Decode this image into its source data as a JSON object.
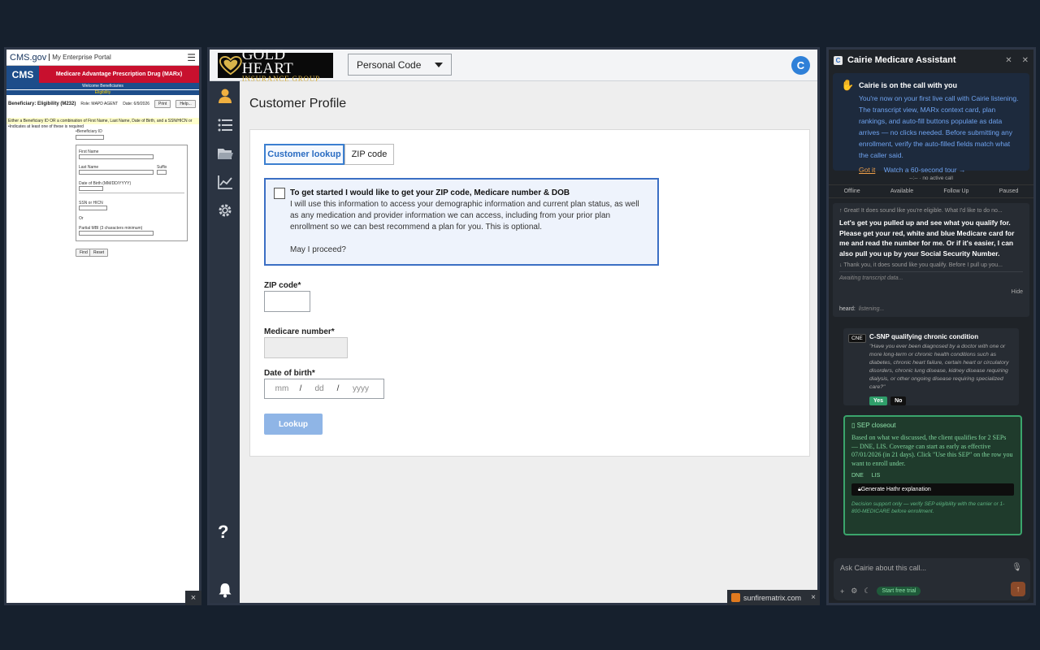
{
  "cms": {
    "brand": "CMS.gov",
    "portal": "My Enterprise Portal",
    "logo": "CMS",
    "banner_title": "Medicare Advantage Prescription Drug (MARx)",
    "welcome": "Welcome Beneficiaries",
    "eligibility": "Eligibility",
    "bene_title": "Beneficiary: Eligibility (M232)",
    "role": "Role: MAPD AGENT",
    "date": "Date: 6/9/2026",
    "print_label": "Print",
    "help_label": "Help...",
    "instructions": "Either a Beneficiary ID OR a combination of First Name, Last Name, Date of Birth, and a SSN/HICN or",
    "required_note": "•Indicates at least one of these is required",
    "beneficiary_id_label": "•Beneficiary ID",
    "first_name_label": "First Name",
    "last_name_label": "Last Name",
    "suffix_label": "Suffix",
    "dob_label": "Date of Birth (MM/DD/YYYY)",
    "ssn_label": "SSN or HICN",
    "or_label": "Or",
    "mbi_label": "Partial MBI (3 characters minimum)",
    "find_label": "Find",
    "reset_label": "Reset",
    "close_label": "×"
  },
  "main": {
    "logo_title": "GOLD HEART",
    "logo_subtitle": "INSURANCE GROUP",
    "personal_code": "Personal Code",
    "avatar_initial": "C",
    "page_title": "Customer Profile",
    "tabs": [
      {
        "label": "Customer lookup"
      },
      {
        "label": "ZIP code"
      }
    ],
    "consent": {
      "heading": "To get started I would like to get your ZIP code, Medicare number & DOB",
      "body": "I will use this information to access your demographic information and current plan status, as well as any medication and provider information we can access, including from your prior plan enrollment so we can best recommend a plan for you. This is optional.",
      "question": "May I proceed?"
    },
    "zip_label": "ZIP code*",
    "medicare_label": "Medicare number*",
    "dob_label": "Date of birth*",
    "dob_mm": "mm",
    "dob_dd": "dd",
    "dob_yyyy": "yyyy",
    "dob_sep": "/",
    "lookup_label": "Lookup",
    "help_icon": "?"
  },
  "cairie": {
    "title": "Cairie Medicare Assistant",
    "onboard_heading": "Cairie is on the call with you",
    "onboard_body": "You're now on your first live call with Cairie listening. The transcript view, MARx context card, plan rankings, and auto-fill buttons populate as data arrives — no clicks needed. Before submitting any enrollment, verify the auto-filled fields match what the caller said.",
    "got_it": "Got it",
    "tour": "Watch a 60-second tour →",
    "call_status": "--:--  ·  no active call",
    "states": [
      "Offline",
      "Available",
      "Follow Up",
      "Paused"
    ],
    "prev_line": "↑ Great! It does sound like you're eligible. What I'd like to do no...",
    "main_line": "Let's get you pulled up and see what you qualify for. Please get your red, white and blue Medicare card for me and read the number for me. Or if it's easier, I can also pull you up by your Social Security Number.",
    "next_line": "↓ Thank you, it does sound like you qualify. Before I pull up you...",
    "awaiting": "Awaiting transcript data...",
    "hide": "Hide",
    "heard_label": "heard:",
    "heard_value": "listening...",
    "cne_tag": "CNE",
    "cne_title": "C-SNP qualifying chronic condition",
    "cne_question": "\"Have you ever been diagnosed by a doctor with one or more long-term or chronic health conditions such as diabetes, chronic heart failure, certain heart or circulatory disorders, chronic lung disease, kidney disease requiring dialysis, or other ongoing disease requiring specialized care?\"",
    "yes": "Yes",
    "no": "No",
    "sep_title": "SEP closeout",
    "sep_body": "Based on what we discussed, the client qualifies for 2 SEPs — DNE, LIS. Coverage can start as early as effective 07/01/2026 (in 21 days). Click \"Use this SEP\" on the row you want to enroll under.",
    "sep_codes": [
      "DNE",
      "LIS"
    ],
    "generate": "Generate Hathr explanation",
    "disclaimer": "Decision support only — verify SEP eligibility with the carrier or 1-800-MEDICARE before enrollment.",
    "ask_placeholder": "Ask Cairie about this call...",
    "trial": "Start free trial"
  },
  "tabs_bar": {
    "site": "sunfirematrix.com",
    "close": "×"
  }
}
